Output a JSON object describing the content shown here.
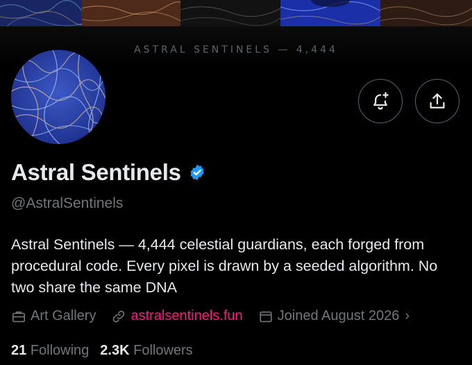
{
  "banner": {
    "caption": "ASTRAL SENTINELS — 4,444",
    "tile_colors": [
      "#1a2a66",
      "#5a2e1c",
      "#141414",
      "#1a2fa8",
      "#3a2118"
    ]
  },
  "profile": {
    "display_name": "Astral Sentinels",
    "handle": "@AstralSentinels",
    "verified": true,
    "bio": "Astral Sentinels — 4,444 celestial guardians, each forged from procedural code. Every pixel is drawn by a seeded algorithm. No two share the same DNA",
    "category": "Art Gallery",
    "website": "astralsentinels.fun",
    "joined": "Joined August 2026",
    "following_count": "21",
    "following_label": "Following",
    "followers_count": "2.3K",
    "followers_label": "Followers"
  },
  "icons": {
    "notify": "bell-plus-icon",
    "share": "share-upload-icon",
    "verified": "verified-badge-icon",
    "category": "briefcase-icon",
    "website": "link-icon",
    "joined": "calendar-icon",
    "more": "chevron-right-icon"
  },
  "colors": {
    "background": "#000000",
    "primary_text": "#e7e9ea",
    "secondary_text": "#71767b",
    "link": "#f91880",
    "verified": "#1d9bf0",
    "button_border": "#536471"
  }
}
